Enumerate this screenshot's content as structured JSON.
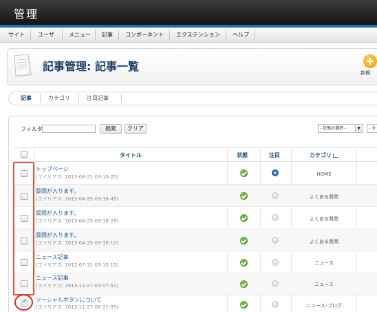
{
  "app": {
    "brand": "管理"
  },
  "menu": [
    "サイト",
    "ユーザ",
    "メニュー",
    "記事",
    "コンポーネント",
    "エクステンション",
    "ヘルプ"
  ],
  "page": {
    "title": "記事管理: 記事一覧",
    "new_label": "新規"
  },
  "tabs": [
    "記事",
    "カテゴリ",
    "注目記事"
  ],
  "filter": {
    "label": "フィルタ:",
    "value": "",
    "search_label": "検索",
    "clear_label": "クリア",
    "state_select": "- 状態の選択 -",
    "next_select": "- カ"
  },
  "table": {
    "headers": {
      "title": "タイトル",
      "status": "状態",
      "featured": "注目",
      "category": "カテゴリ"
    },
    "rows": [
      {
        "title": "トップページ",
        "alias": "(エイリアス: 2013-08-21-03-10-25)",
        "published": true,
        "featured": true,
        "category": "HOME",
        "checked": false
      },
      {
        "title": "質問が入ります。",
        "alias": "(エイリアス: 2013-04-25-09-18-45)",
        "published": true,
        "featured": false,
        "category": "よくある質問",
        "checked": false
      },
      {
        "title": "質問が入ります。",
        "alias": "(エイリアス: 2013-04-25-09-18-26)",
        "published": true,
        "featured": false,
        "category": "よくある質問",
        "checked": false
      },
      {
        "title": "質問が入ります。",
        "alias": "(エイリアス: 2013-04-25-09-18-10)",
        "published": true,
        "featured": false,
        "category": "よくある質問",
        "checked": false
      },
      {
        "title": "ニュース記事",
        "alias": "(エイリアス: 2012-07-31-03-15-15)",
        "published": true,
        "featured": false,
        "category": "ニュース",
        "checked": false
      },
      {
        "title": "ニュース記事",
        "alias": "(エイリアス: 2013-11-27-03-57-52)",
        "published": true,
        "featured": false,
        "category": "ニュース",
        "checked": false
      },
      {
        "title": "ソーシャルボタンについて",
        "alias": "(エイリアス: 2013-11-27-06-21-09)",
        "published": true,
        "featured": false,
        "category": "ニュース･ブログ",
        "checked": true
      }
    ]
  },
  "colors": {
    "accent": "#1b6fb5",
    "highlight": "#e8542f",
    "link": "#1a5a9a"
  }
}
